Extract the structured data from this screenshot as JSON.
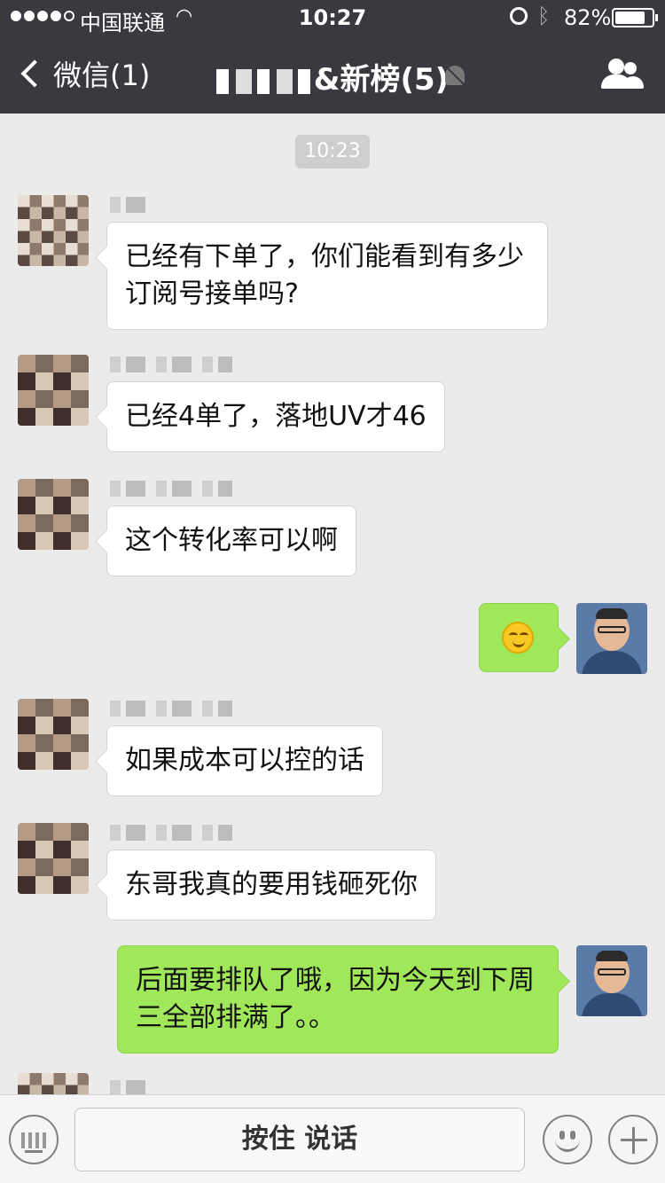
{
  "status_bar": {
    "carrier": "中国联通",
    "time": "10:27",
    "battery_percent": "82%",
    "battery_level": 0.82
  },
  "nav": {
    "back_label": "微信(1)",
    "title": "&新榜(5)"
  },
  "chat": {
    "timestamp": "10:23",
    "messages": [
      {
        "side": "left",
        "text": "已经有下单了，你们能看到有多少订阅号接单吗?"
      },
      {
        "side": "left",
        "text": "已经4单了，落地UV才46"
      },
      {
        "side": "left",
        "text": "这个转化率可以啊"
      },
      {
        "side": "right",
        "icon": "grin-emoji-icon"
      },
      {
        "side": "left",
        "text": "如果成本可以控的话"
      },
      {
        "side": "left",
        "text": "东哥我真的要用钱砸死你"
      },
      {
        "side": "right",
        "text": "后面要排队了哦，因为今天到下周三全部排满了。。"
      }
    ]
  },
  "input_bar": {
    "hold_to_talk_label": "按住 说话"
  },
  "colors": {
    "nav_bg": "#393a3f",
    "chat_bg": "#ebebeb",
    "outgoing_bubble": "#a0e75a",
    "incoming_bubble": "#ffffff"
  }
}
